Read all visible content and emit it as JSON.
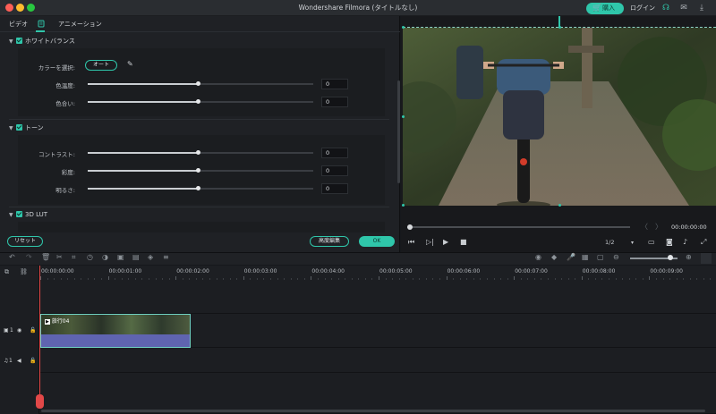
{
  "titlebar": {
    "title": "Wondershare Filmora (タイトルなし)",
    "buy_label": "購入",
    "login_label": "ログイン"
  },
  "tabs": {
    "video": "ビデオ",
    "color_icon": "color-palette-icon",
    "animation": "アニメーション"
  },
  "white_balance": {
    "heading": "ホワイトバランス",
    "color_pick_label": "カラーを選択:",
    "auto_label": "オート",
    "rows": [
      {
        "label": "色温度:",
        "value": "0",
        "level": 0.49
      },
      {
        "label": "色合い:",
        "value": "0",
        "level": 0.49
      }
    ]
  },
  "tone": {
    "heading": "トーン",
    "rows": [
      {
        "label": "コントラスト:",
        "value": "0",
        "level": 0.49
      },
      {
        "label": "彩度:",
        "value": "0",
        "level": 0.49
      },
      {
        "label": "明るさ:",
        "value": "0",
        "level": 0.49
      }
    ]
  },
  "lut": {
    "heading": "3D LUT"
  },
  "buttons": {
    "reset": "リセット",
    "advanced": "高度編集",
    "ok": "OK"
  },
  "player": {
    "timecode": "00:00:00:00",
    "ratio": "1/2",
    "progress": 0
  },
  "timeline": {
    "ticks": [
      "00:00:00:00",
      "00:00:01:00",
      "00:00:02:00",
      "00:00:03:00",
      "00:00:04:00",
      "00:00:05:00",
      "00:00:06:00",
      "00:00:07:00",
      "00:00:08:00",
      "00:00:09:00"
    ],
    "clip_name": "旅行04",
    "video_track_label": "1",
    "audio_track_label": "1",
    "zoom_level": 0.8
  },
  "colors": {
    "accent": "#2fc6aa",
    "playhead": "#e24848",
    "clip_audio": "#5f64b0"
  }
}
